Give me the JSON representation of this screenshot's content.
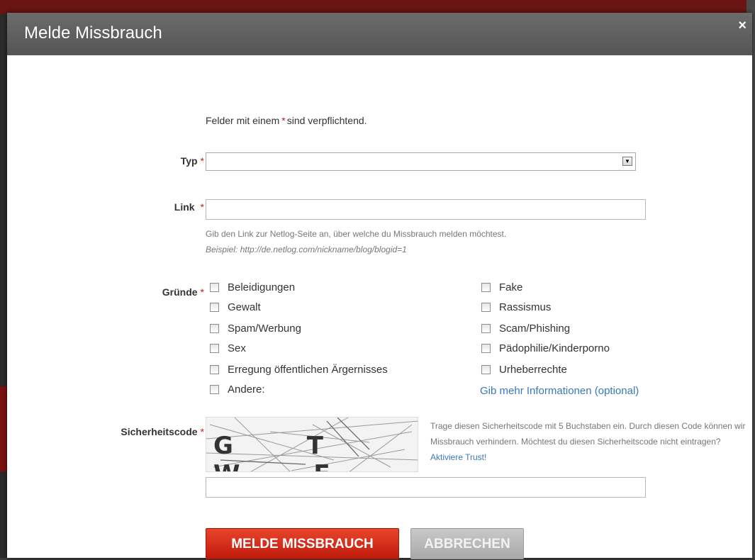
{
  "dialog": {
    "title": "Melde Missbrauch",
    "close_icon": "×"
  },
  "form": {
    "required_note_prefix": "Felder mit einem",
    "required_note_suffix": "sind verpflichtend.",
    "asterisk": "*",
    "type_label": "Typ",
    "type_value": "",
    "link_label": "Link",
    "link_value": "",
    "link_hint": "Gib den Link zur Netlog-Seite an, über welche du Missbrauch melden möchtest.",
    "link_example": "Beispiel: http://de.netlog.com/nickname/blog/blogid=1",
    "reasons_label": "Gründe",
    "reasons_left": [
      "Beleidigungen",
      "Gewalt",
      "Spam/Werbung",
      "Sex",
      "Erregung öffentlichen Ärgernisses",
      "Andere:"
    ],
    "reasons_right": [
      "Fake",
      "Rassismus",
      "Scam/Phishing",
      "Pädophilie/Kinderporno",
      "Urheberrechte"
    ],
    "more_info_link": "Gib mehr Informationen (optional)",
    "captcha_label": "Sicherheitscode",
    "captcha_letters": "G T W F",
    "captcha_text": "Trage diesen Sicherheitscode mit 5 Buchstaben ein. Durch diesen Code können wir Missbrauch verhindern. Möchtest du diesen Sicherheitscode nicht eintragen?",
    "captcha_link": "Aktiviere Trust!",
    "captcha_value": ""
  },
  "buttons": {
    "submit": "MELDE MISSBRAUCH",
    "cancel": "ABBRECHEN"
  },
  "colors": {
    "header": "#5e5e5e",
    "required": "#cc1a1a",
    "submit": "#d82d1a",
    "cancel": "#b5b5b5",
    "link": "#3b78b8"
  }
}
